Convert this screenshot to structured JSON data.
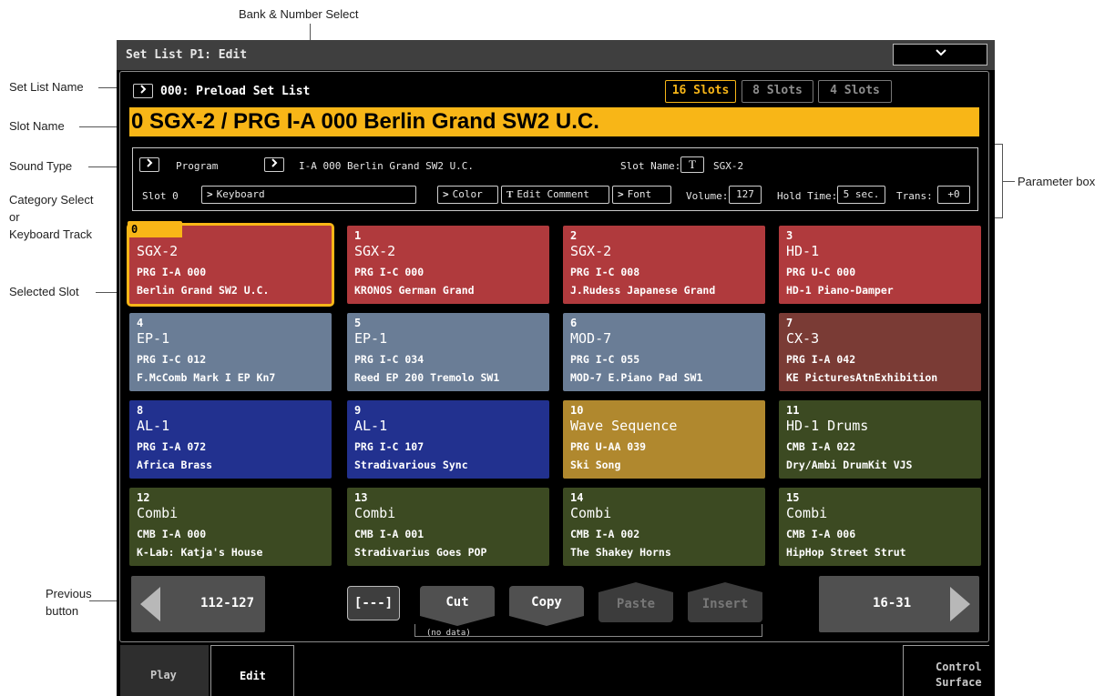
{
  "callouts": {
    "set_list_name": "Set List Name",
    "slot_name": "Slot Name",
    "sound_type": "Sound Type",
    "category_select": "Category Select",
    "or": "or",
    "keyboard_track": "Keyboard Track",
    "selected_slot": "Selected Slot",
    "previous_line1": "Previous",
    "previous_line2": "button",
    "bank_number_select": "Bank & Number Select",
    "parameter_box": "Parameter box"
  },
  "titlebar": {
    "title": "Set List P1: Edit",
    "menu_icon": "chevron-down-icon"
  },
  "setlist": {
    "name": "000: Preload Set List"
  },
  "slot_modes": [
    {
      "label": "16 Slots",
      "active": true
    },
    {
      "label": "8 Slots",
      "active": false
    },
    {
      "label": "4 Slots",
      "active": false
    }
  ],
  "slot_name_bar": "0 SGX-2 / PRG I-A 000 Berlin Grand SW2 U.C.",
  "params": {
    "sound_type": "Program",
    "program": "I-A 000 Berlin Grand SW2 U.C.",
    "slot_name_label": "Slot Name:",
    "slot_name_value": "SGX-2",
    "slot_label": "Slot 0",
    "category": "Keyboard",
    "color": "Color",
    "edit_comment": "Edit Comment",
    "font": "Font",
    "volume_label": "Volume:",
    "volume": "127",
    "hold_label": "Hold Time:",
    "hold": "5 sec.",
    "trans_label": "Trans:",
    "trans": "+0"
  },
  "selected_tab": "0",
  "slots": [
    {
      "num": "",
      "type": "SGX-2",
      "prog": "PRG I-A 000",
      "name": "Berlin Grand SW2 U.C.",
      "color": "#b03a3d"
    },
    {
      "num": "1",
      "type": "SGX-2",
      "prog": "PRG I-C 000",
      "name": "KRONOS German Grand",
      "color": "#b03a3d"
    },
    {
      "num": "2",
      "type": "SGX-2",
      "prog": "PRG I-C 008",
      "name": "J.Rudess Japanese Grand",
      "color": "#b03a3d"
    },
    {
      "num": "3",
      "type": "HD-1",
      "prog": "PRG U-C 000",
      "name": "HD-1 Piano-Damper",
      "color": "#b03a3d"
    },
    {
      "num": "4",
      "type": "EP-1",
      "prog": "PRG I-C 012",
      "name": "F.McComb Mark I EP Kn7",
      "color": "#6a7d96"
    },
    {
      "num": "5",
      "type": "EP-1",
      "prog": "PRG I-C 034",
      "name": "Reed EP 200 Tremolo SW1",
      "color": "#6a7d96"
    },
    {
      "num": "6",
      "type": "MOD-7",
      "prog": "PRG I-C 055",
      "name": "MOD-7 E.Piano Pad SW1",
      "color": "#6a7d96"
    },
    {
      "num": "7",
      "type": "CX-3",
      "prog": "PRG I-A 042",
      "name": "KE PicturesAtnExhibition",
      "color": "#7a3b35"
    },
    {
      "num": "8",
      "type": "AL-1",
      "prog": "PRG I-A 072",
      "name": "Africa Brass",
      "color": "#22318f"
    },
    {
      "num": "9",
      "type": "AL-1",
      "prog": "PRG I-C 107",
      "name": "Stradivarious Sync",
      "color": "#22318f"
    },
    {
      "num": "10",
      "type": "Wave Sequence",
      "prog": "PRG U-AA 039",
      "name": "Ski Song",
      "color": "#b0882e"
    },
    {
      "num": "11",
      "type": "HD-1 Drums",
      "prog": "CMB I-A 022",
      "name": "Dry/Ambi DrumKit VJS",
      "color": "#3c4a22"
    },
    {
      "num": "12",
      "type": "Combi",
      "prog": "CMB I-A 000",
      "name": "K-Lab: Katja's House",
      "color": "#3c4a22"
    },
    {
      "num": "13",
      "type": "Combi",
      "prog": "CMB I-A 001",
      "name": "Stradivarius Goes POP",
      "color": "#3c4a22"
    },
    {
      "num": "14",
      "type": "Combi",
      "prog": "CMB I-A 002",
      "name": "The Shakey Horns",
      "color": "#3c4a22"
    },
    {
      "num": "15",
      "type": "Combi",
      "prog": "CMB I-A 006",
      "name": "HipHop Street Strut",
      "color": "#3c4a22"
    }
  ],
  "nav": {
    "prev": "112-127",
    "next": "16-31"
  },
  "edit_buttons": {
    "bracket": "[---]",
    "cut": "Cut",
    "copy": "Copy",
    "paste": "Paste",
    "insert": "Insert",
    "no_data": "(no data)"
  },
  "tabs": {
    "play": "Play",
    "edit": "Edit",
    "control_line1": "Control",
    "control_line2": "Surface"
  }
}
